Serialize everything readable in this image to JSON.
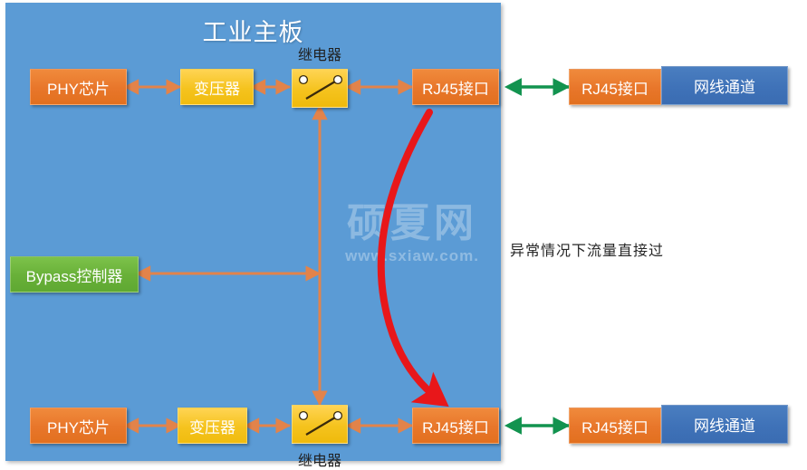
{
  "board": {
    "title": "工业主板",
    "fill_color": "#5b9bd5"
  },
  "watermark": {
    "brand": "硕夏网",
    "url": "www.sxiaw.com."
  },
  "colors": {
    "orange_node": "#e8762a",
    "yellow_node": "#f5c31e",
    "green_node": "#68b038",
    "blue_node": "#3f72b8",
    "orange_arrow": "#e2834a",
    "green_arrow": "#12934f",
    "red_arrow": "#e8171a",
    "board_blue": "#5b9bd5"
  },
  "top_chain": {
    "phy_chip": "PHY芯片",
    "transformer": "变压器",
    "relay_label": "继电器",
    "rj45_internal": "RJ45接口",
    "rj45_external": "RJ45接口",
    "cable_channel": "网线通道"
  },
  "bottom_chain": {
    "phy_chip": "PHY芯片",
    "transformer": "变压器",
    "relay_label": "继电器",
    "rj45_internal": "RJ45接口",
    "rj45_external": "RJ45接口",
    "cable_channel": "网线通道"
  },
  "controller": {
    "label": "Bypass控制器"
  },
  "annotations": {
    "bypass_flow": "异常情况下流量直接过"
  }
}
